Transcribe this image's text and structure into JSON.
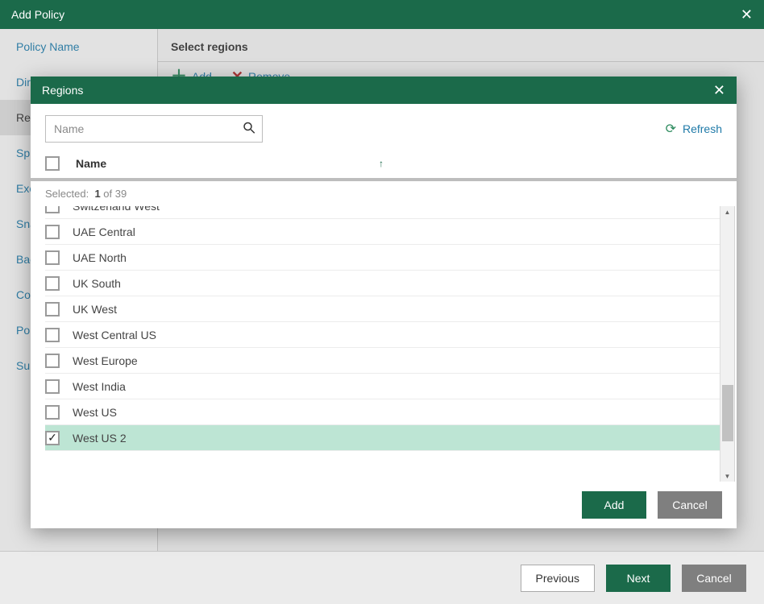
{
  "outer_dialog": {
    "title": "Add Policy",
    "toolbar": {
      "section_title": "Select regions",
      "add_label": "Add",
      "remove_label": "Remove"
    },
    "footer": {
      "previous_label": "Previous",
      "next_label": "Next",
      "cancel_label": "Cancel"
    }
  },
  "sidebar": {
    "items": [
      {
        "label": "Policy Name",
        "selected": false,
        "truncated": "Policy Name"
      },
      {
        "label": "Directories",
        "selected": false,
        "truncated": "Dir"
      },
      {
        "label": "Regions",
        "selected": true,
        "truncated": "Reg"
      },
      {
        "label": "Specify",
        "selected": false,
        "truncated": "Sp"
      },
      {
        "label": "Exclusions",
        "selected": false,
        "truncated": "Exc"
      },
      {
        "label": "Snapshots",
        "selected": false,
        "truncated": "Sna"
      },
      {
        "label": "Backup",
        "selected": false,
        "truncated": "Bac"
      },
      {
        "label": "Cost",
        "selected": false,
        "truncated": "Cos"
      },
      {
        "label": "Policies",
        "selected": false,
        "truncated": "Pol"
      },
      {
        "label": "Summary",
        "selected": false,
        "truncated": "Sur"
      }
    ]
  },
  "regions_modal": {
    "title": "Regions",
    "search_placeholder": "Name",
    "refresh_label": "Refresh",
    "header_name": "Name",
    "selected_label": "Selected:",
    "selected_count": "1",
    "total_suffix": "of 39",
    "footer": {
      "add_label": "Add",
      "cancel_label": "Cancel"
    },
    "rows": [
      {
        "name": "Switzerland West",
        "checked": false,
        "partial": true
      },
      {
        "name": "UAE Central",
        "checked": false
      },
      {
        "name": "UAE North",
        "checked": false
      },
      {
        "name": "UK South",
        "checked": false
      },
      {
        "name": "UK West",
        "checked": false
      },
      {
        "name": "West Central US",
        "checked": false
      },
      {
        "name": "West Europe",
        "checked": false
      },
      {
        "name": "West India",
        "checked": false
      },
      {
        "name": "West US",
        "checked": false
      },
      {
        "name": "West US 2",
        "checked": true
      }
    ]
  }
}
